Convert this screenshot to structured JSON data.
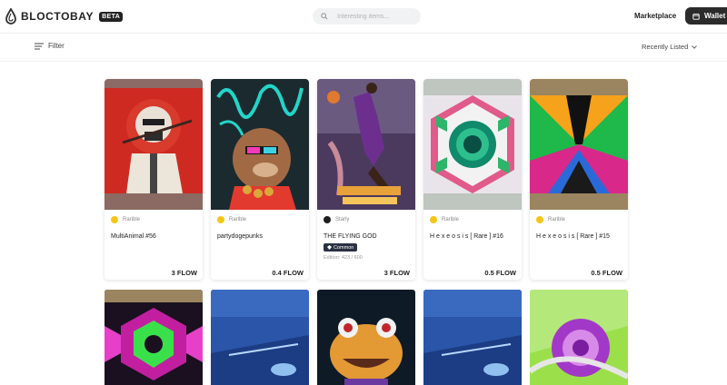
{
  "header": {
    "logo_text": "BLOCTOBAY",
    "beta_label": "BETA",
    "search_placeholder": "Interesting items...",
    "nav_marketplace": "Marketplace",
    "wallet_label": "Wallet"
  },
  "toolbar": {
    "filter_label": "Filter",
    "sort_label": "Recently Listed"
  },
  "cards": [
    {
      "source": "Rarible",
      "name": "MultiAnimal #56",
      "price": "3 FLOW"
    },
    {
      "source": "Rarible",
      "name": "partydogepunks",
      "price": "0.4 FLOW"
    },
    {
      "source": "Starly",
      "name": "THE FLYING GOD",
      "badge": "Common",
      "edition": "Edition: 423 / 600",
      "price": "3 FLOW"
    },
    {
      "source": "Rarible",
      "name": "H e x e o s i s [ Rare ] #16",
      "price": "0.5 FLOW"
    },
    {
      "source": "Rarible",
      "name": "H e x e o s i s [ Rare ] #15",
      "price": "0.5 FLOW"
    }
  ],
  "colors": {
    "rarible_badge": "#f5c518",
    "starly_badge": "#1e1e1e",
    "wallet_bg": "#2b2b2b",
    "common_badge": "#2a3140"
  }
}
